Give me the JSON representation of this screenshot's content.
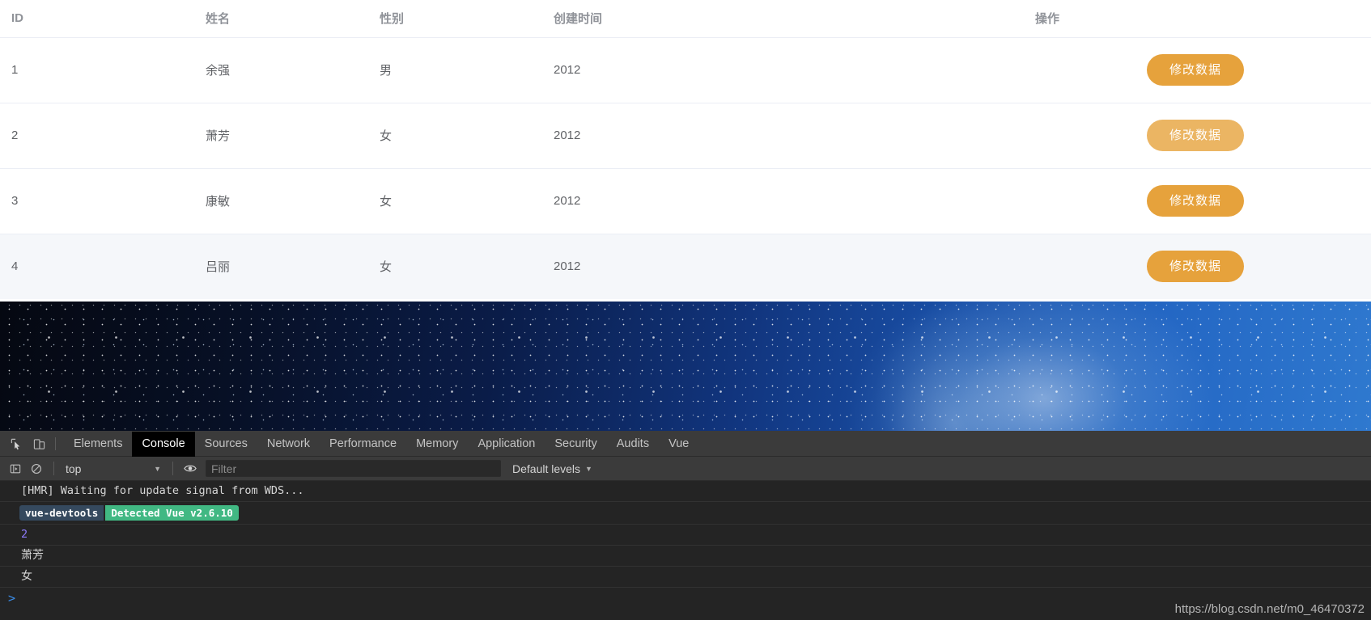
{
  "table": {
    "columns": [
      {
        "key": "id",
        "label": "ID"
      },
      {
        "key": "name",
        "label": "姓名"
      },
      {
        "key": "gender",
        "label": "性别"
      },
      {
        "key": "created",
        "label": "创建时间"
      },
      {
        "key": "action",
        "label": "操作"
      }
    ],
    "rows": [
      {
        "id": "1",
        "name": "余强",
        "gender": "男",
        "created": "2012",
        "action_label": "修改数据",
        "button_state": "normal",
        "row_state": "normal"
      },
      {
        "id": "2",
        "name": "萧芳",
        "gender": "女",
        "created": "2012",
        "action_label": "修改数据",
        "button_state": "hover",
        "row_state": "normal"
      },
      {
        "id": "3",
        "name": "康敏",
        "gender": "女",
        "created": "2012",
        "action_label": "修改数据",
        "button_state": "normal",
        "row_state": "normal"
      },
      {
        "id": "4",
        "name": "吕丽",
        "gender": "女",
        "created": "2012",
        "action_label": "修改数据",
        "button_state": "normal",
        "row_state": "hover"
      }
    ],
    "colors": {
      "header_text": "#909399",
      "cell_text": "#606266",
      "row_border": "#ebeef5",
      "row_hover_bg": "#f5f7fa",
      "button_bg": "#e6a23c",
      "button_bg_hover": "#ebb563",
      "button_text": "#ffffff"
    }
  },
  "devtools": {
    "tabs": [
      {
        "label": "Elements",
        "active": false
      },
      {
        "label": "Console",
        "active": true
      },
      {
        "label": "Sources",
        "active": false
      },
      {
        "label": "Network",
        "active": false
      },
      {
        "label": "Performance",
        "active": false
      },
      {
        "label": "Memory",
        "active": false
      },
      {
        "label": "Application",
        "active": false
      },
      {
        "label": "Security",
        "active": false
      },
      {
        "label": "Audits",
        "active": false
      },
      {
        "label": "Vue",
        "active": false
      }
    ],
    "toolbar": {
      "inspect_icon": "inspect-element-icon",
      "device_icon": "device-toolbar-icon"
    },
    "filterbar": {
      "execute_icon": "execute-sidebar-icon",
      "clear_icon": "clear-console-icon",
      "context_value": "top",
      "context_caret": "▼",
      "eye_icon": "live-expression-eye-icon",
      "filter_placeholder": "Filter",
      "filter_value": "",
      "levels_label": "Default levels",
      "levels_caret": "▼"
    },
    "console_logs": [
      {
        "type": "text",
        "text": "[HMR] Waiting for update signal from WDS...",
        "style": "mono"
      },
      {
        "type": "badge",
        "left_text": "vue-devtools",
        "right_text": "Detected Vue v2.6.10",
        "left_color": "#35495e",
        "right_color": "#41b883"
      },
      {
        "type": "text",
        "text": "2",
        "style": "num"
      },
      {
        "type": "text",
        "text": "萧芳",
        "style": "cjk"
      },
      {
        "type": "text",
        "text": "女",
        "style": "cjk"
      }
    ],
    "prompt_symbol": ">",
    "colors": {
      "panel_bg": "#242424",
      "bar_bg": "#3b3b3b",
      "active_tab_bg": "#000000",
      "prompt_color": "#3b8eea"
    }
  },
  "watermark": {
    "text": "https://blog.csdn.net/m0_46470372"
  }
}
